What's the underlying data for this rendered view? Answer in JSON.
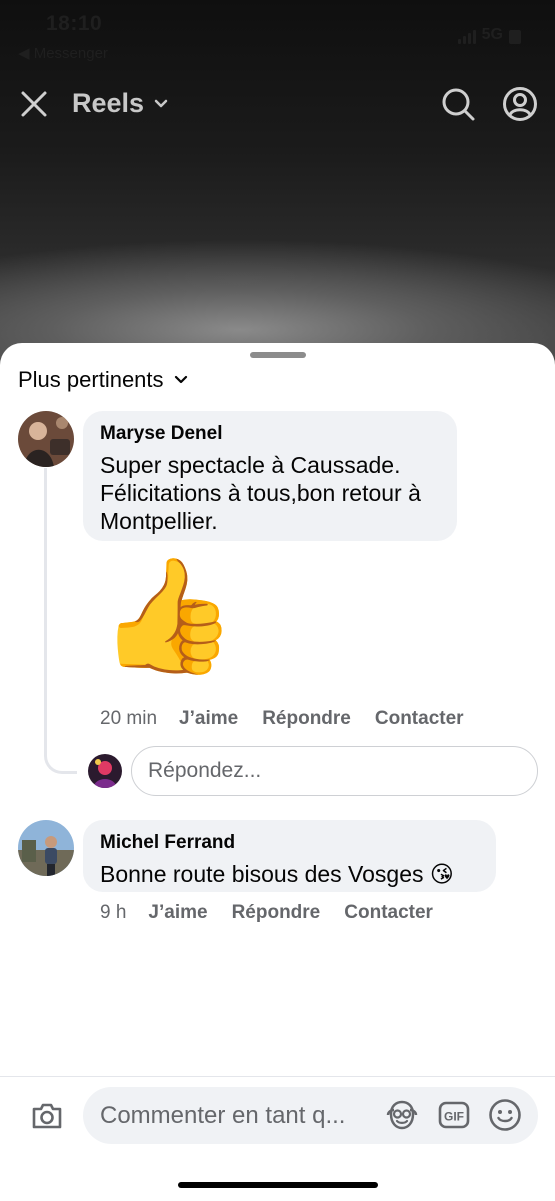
{
  "status_bar": {
    "time": "18:10",
    "back_app": "◀ Messenger",
    "network": "5G"
  },
  "header": {
    "title": "Reels"
  },
  "sheet": {
    "sort_label": "Plus pertinents"
  },
  "comments": [
    {
      "author": "Maryse Denel",
      "lines": [
        "Super spectacle à Caussade.",
        "Félicitations à tous,bon retour à",
        "Montpellier."
      ],
      "sticker": "👍",
      "time": "20 min",
      "like": "J’aime",
      "reply": "Répondre",
      "contact": "Contacter"
    },
    {
      "author": "Michel Ferrand",
      "text": "Bonne route bisous des Vosges 😘",
      "time": "9 h",
      "like": "J’aime",
      "reply": "Répondre",
      "contact": "Contacter"
    }
  ],
  "reply_box": {
    "placeholder": "Répondez..."
  },
  "composer": {
    "placeholder": "Commenter en tant q...",
    "gif_label": "GIF"
  },
  "colors": {
    "bubble": "#f0f2f5",
    "secondary_text": "#65676b",
    "primary_text": "#050505"
  }
}
